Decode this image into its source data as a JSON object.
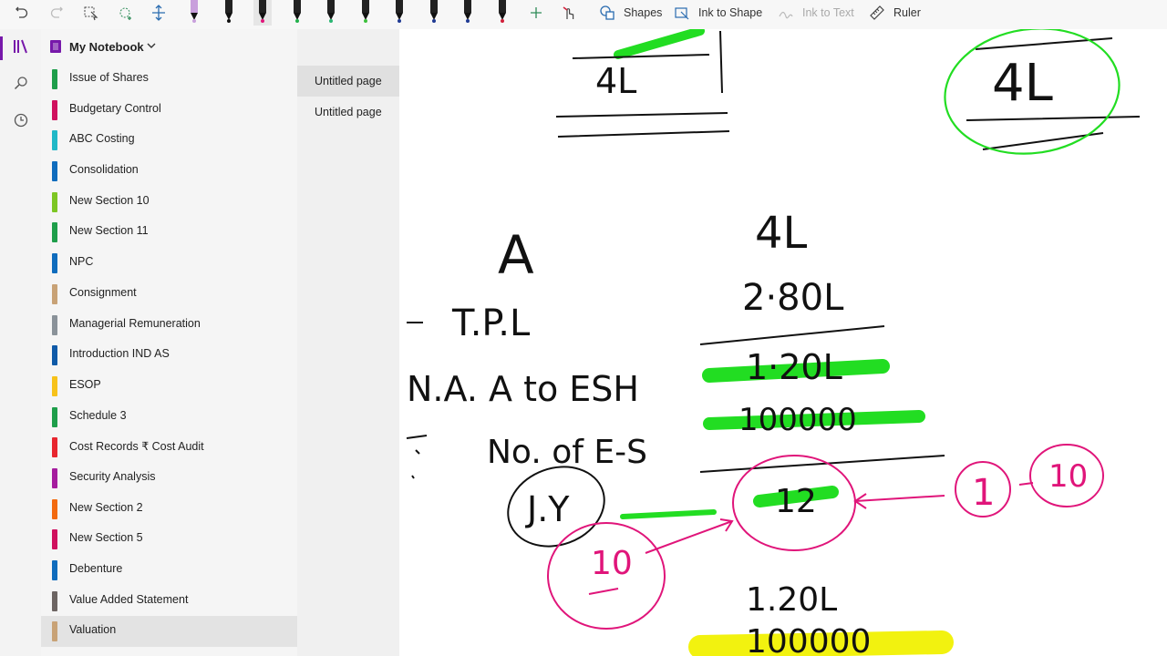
{
  "toolbar": {
    "shapes_label": "Shapes",
    "ink_to_shape_label": "Ink to Shape",
    "ink_to_text_label": "Ink to Text",
    "ruler_label": "Ruler",
    "pens": [
      {
        "name": "pen-lavender",
        "color": "#c9a0dc"
      },
      {
        "name": "pen-black-1",
        "color": "#111111"
      },
      {
        "name": "pen-magenta",
        "color": "#e0157a"
      },
      {
        "name": "pen-green-1",
        "color": "#22b14c"
      },
      {
        "name": "pen-green-2",
        "color": "#2bb673"
      },
      {
        "name": "pen-green-3",
        "color": "#3cc03c"
      },
      {
        "name": "pen-navy-1",
        "color": "#1f3a93"
      },
      {
        "name": "pen-navy-2",
        "color": "#1f3a93"
      },
      {
        "name": "pen-navy-3",
        "color": "#1f3a93"
      },
      {
        "name": "pen-red",
        "color": "#d11f3a"
      }
    ],
    "icons": [
      "undo-icon",
      "redo-icon",
      "lasso-select-icon",
      "add-space-icon",
      "insert-space-icon",
      "add-pen-icon",
      "touch-draw-icon",
      "shapes-icon",
      "ink-to-shape-icon",
      "ink-to-text-icon",
      "ruler-icon"
    ]
  },
  "rail": {
    "icons": [
      "notebooks-icon",
      "search-icon",
      "recent-icon"
    ],
    "accent": "#7719aa"
  },
  "notebook": {
    "title": "My Notebook",
    "color": "#7719aa"
  },
  "sections": [
    {
      "label": "Issue of Shares",
      "color": "#1e9e4a"
    },
    {
      "label": "Budgetary Control",
      "color": "#d0115e"
    },
    {
      "label": "ABC Costing",
      "color": "#20b8c7"
    },
    {
      "label": "Consolidation",
      "color": "#0f6cbd"
    },
    {
      "label": "New Section 10",
      "color": "#7dc623"
    },
    {
      "label": "New Section 11",
      "color": "#1e9e4a"
    },
    {
      "label": "NPC",
      "color": "#0f6cbd"
    },
    {
      "label": "Consignment",
      "color": "#c8a276"
    },
    {
      "label": "Managerial Remuneration",
      "color": "#8a9299"
    },
    {
      "label": "Introduction IND AS",
      "color": "#0f5aa8"
    },
    {
      "label": "ESOP",
      "color": "#f7c21a"
    },
    {
      "label": "Schedule 3",
      "color": "#1e9e4a"
    },
    {
      "label": "Cost Records ₹ Cost Audit",
      "color": "#e8262f"
    },
    {
      "label": "Security Analysis",
      "color": "#a51c9e"
    },
    {
      "label": "New Section 2",
      "color": "#f36a10"
    },
    {
      "label": "New Section 5",
      "color": "#d0115e"
    },
    {
      "label": "Debenture",
      "color": "#0f6cbd"
    },
    {
      "label": "Value Added Statement",
      "color": "#6d6563"
    },
    {
      "label": "Valuation",
      "color": "#c8a276"
    }
  ],
  "active_section_index": 18,
  "pages": [
    {
      "label": "Untitled page",
      "active": true
    },
    {
      "label": "Untitled page",
      "active": false
    }
  ],
  "ink": {
    "t1": "4L",
    "t2": "4L",
    "t3": "A",
    "t4": "4L",
    "t5": "2·80L",
    "t6": "T.P.L",
    "t7": "N.A. A to ESH",
    "t8": "1·20L",
    "t9": "No. of E-S",
    "t10": "100000",
    "t11": "J.Y",
    "t12": "12",
    "t13": "1",
    "t14": "10",
    "t15": "10",
    "t16": "1.20L",
    "t17": "100000",
    "ink_black": "#111111",
    "ink_green": "#22dd22",
    "ink_pink": "#e0157a",
    "ink_yellow": "#f2f20f"
  }
}
